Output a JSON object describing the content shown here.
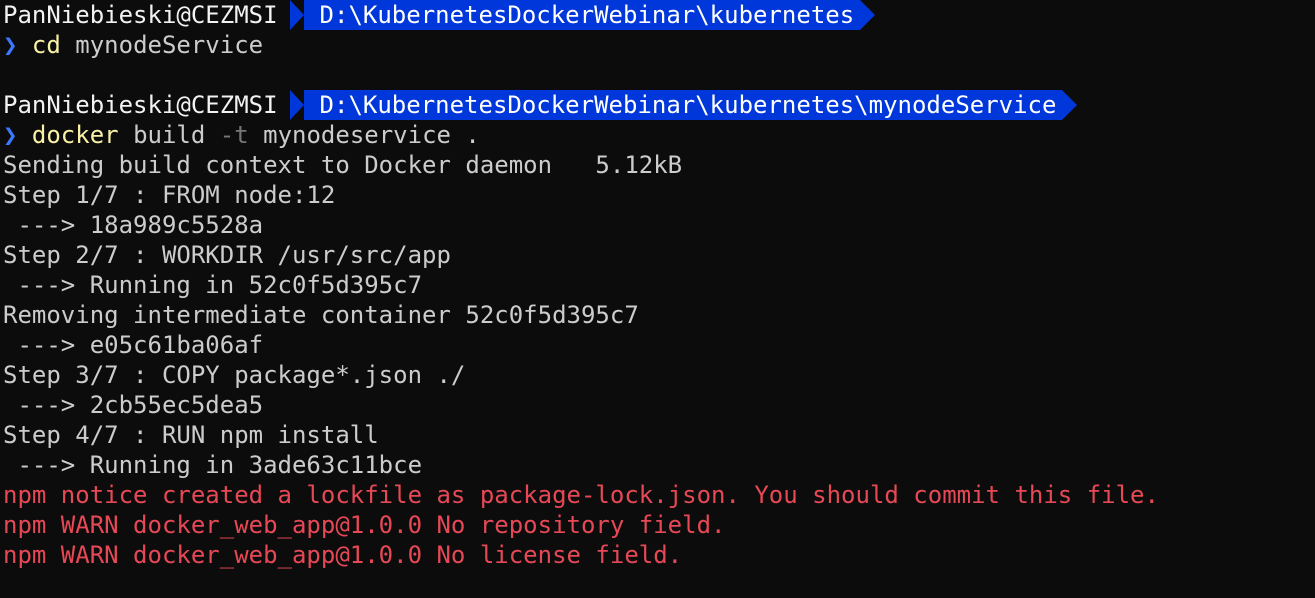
{
  "colors": {
    "background": "#0c0c0c",
    "text": "#cccccc",
    "path_segment_bg": "#0037da",
    "prompt_chevron": "#3b78ff",
    "command": "#f9f1a5",
    "flag": "#767676",
    "error": "#e74856"
  },
  "prompt1": {
    "user": "PanNiebieski@CEZMSI",
    "path": "D:\\KubernetesDockerWebinar\\kubernetes"
  },
  "cmd1": {
    "chevron": "❯",
    "command": "cd",
    "args": "mynodeService"
  },
  "prompt2": {
    "user": "PanNiebieski@CEZMSI",
    "path": "D:\\KubernetesDockerWebinar\\kubernetes\\mynodeService"
  },
  "cmd2": {
    "chevron": "❯",
    "command": "docker",
    "sub": "build",
    "flag": "-t",
    "args": "mynodeservice ."
  },
  "output": [
    "Sending build context to Docker daemon   5.12kB",
    "Step 1/7 : FROM node:12",
    " ---> 18a989c5528a",
    "Step 2/7 : WORKDIR /usr/src/app",
    " ---> Running in 52c0f5d395c7",
    "Removing intermediate container 52c0f5d395c7",
    " ---> e05c61ba06af",
    "Step 3/7 : COPY package*.json ./",
    " ---> 2cb55ec5dea5",
    "Step 4/7 : RUN npm install",
    " ---> Running in 3ade63c11bce"
  ],
  "errors": [
    "npm notice created a lockfile as package-lock.json. You should commit this file.",
    "npm WARN docker_web_app@1.0.0 No repository field.",
    "npm WARN docker_web_app@1.0.0 No license field."
  ]
}
